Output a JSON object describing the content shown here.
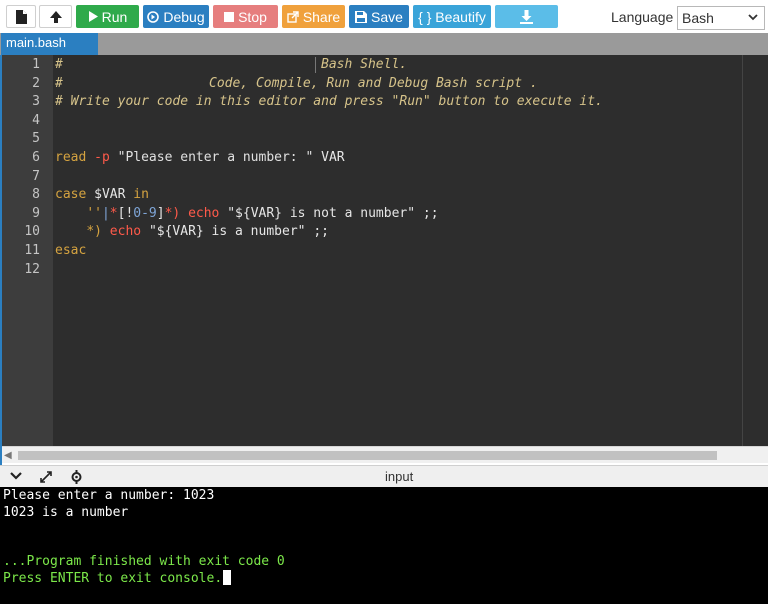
{
  "toolbar": {
    "run": "Run",
    "debug": "Debug",
    "stop": "Stop",
    "share": "Share",
    "save": "Save",
    "beautify": "{ } Beautify",
    "language_label": "Language",
    "language_value": "Bash",
    "colors": {
      "run": "#2faa4b",
      "debug": "#2b7fc1",
      "stop": "#e67e7e",
      "share": "#f0a13c",
      "save": "#2b7fc1",
      "beautify": "#3aa4d9",
      "download": "#5bbde8"
    }
  },
  "tabs": [
    {
      "label": "main.bash"
    }
  ],
  "editor": {
    "line_numbers": [
      "1",
      "2",
      "3",
      "4",
      "5",
      "6",
      "7",
      "8",
      "9",
      "10",
      "11",
      "12"
    ],
    "lines": {
      "l1": {
        "hash": "#",
        "text": "Bash Shell."
      },
      "l2": {
        "hash": "#",
        "text": "Code, Compile, Run and Debug Bash script ."
      },
      "l3": "# Write your code in this editor and press \"Run\" button to execute it.",
      "l6": {
        "kw": "read",
        "flag": "-p",
        "str": "\"Please enter a number: \"",
        "var": "VAR"
      },
      "l8": {
        "kw": "case",
        "var": "$VAR",
        "in": "in"
      },
      "l9": {
        "q": "''",
        "pipe": "|",
        "pat_a": "*",
        "pat_b": "[!",
        "pat_c": "0-9",
        "pat_d": "]",
        "pat_e": "*)",
        "echo": "echo",
        "str": "\"${VAR} is not a number\"",
        "end": ";;"
      },
      "l10": {
        "pat": "*)",
        "echo": "echo",
        "str": "\"${VAR} is a number\"",
        "end": ";;"
      },
      "l11": {
        "kw": "esac"
      }
    }
  },
  "input_panel": {
    "title": "input"
  },
  "console": {
    "lines": [
      "Please enter a number: 1023",
      "1023 is a number",
      "",
      "",
      "...Program finished with exit code 0",
      "Press ENTER to exit console."
    ]
  }
}
